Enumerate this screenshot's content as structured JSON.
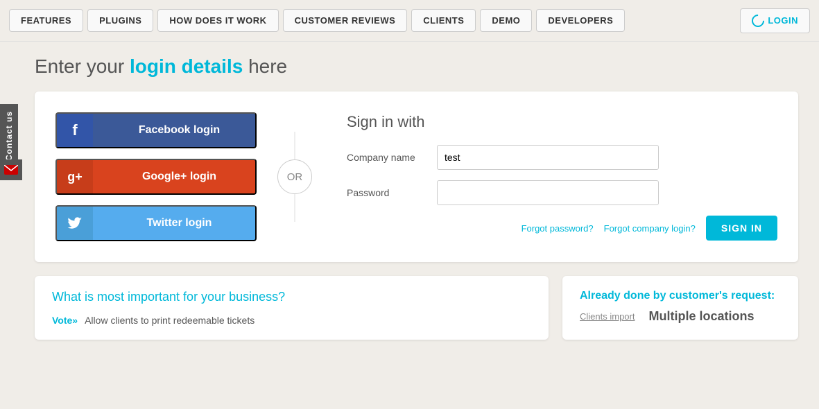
{
  "nav": {
    "items": [
      {
        "label": "FEATURES",
        "id": "features"
      },
      {
        "label": "PLUGINS",
        "id": "plugins"
      },
      {
        "label": "HOW DOES IT WORK",
        "id": "how-does-it-work"
      },
      {
        "label": "CUSTOMER REVIEWS",
        "id": "customer-reviews"
      },
      {
        "label": "CLIENTS",
        "id": "clients"
      },
      {
        "label": "DEMO",
        "id": "demo"
      },
      {
        "label": "DEVELOPERS",
        "id": "developers"
      }
    ],
    "login_label": "LOGIN"
  },
  "contact": {
    "label": "Contact us"
  },
  "page": {
    "title_start": "Enter your ",
    "title_highlight": "login details",
    "title_end": " here"
  },
  "social": {
    "facebook_label": "Facebook login",
    "google_label": "Google+ login",
    "twitter_label": "Twitter login",
    "or_label": "OR"
  },
  "form": {
    "title": "Sign in with",
    "company_label": "Company name",
    "company_value": "test",
    "password_label": "Password",
    "password_value": "",
    "forgot_password": "Forgot password?",
    "forgot_company": "Forgot company login?",
    "sign_in_label": "SIGN IN"
  },
  "bottom_left": {
    "title": "What is most important for your business?",
    "vote_label": "Vote»",
    "suggestion": "Allow clients to print redeemable tickets"
  },
  "bottom_right": {
    "title": "Already done by customer's request:",
    "link1": "Clients import",
    "link2": "Multiple locations"
  }
}
